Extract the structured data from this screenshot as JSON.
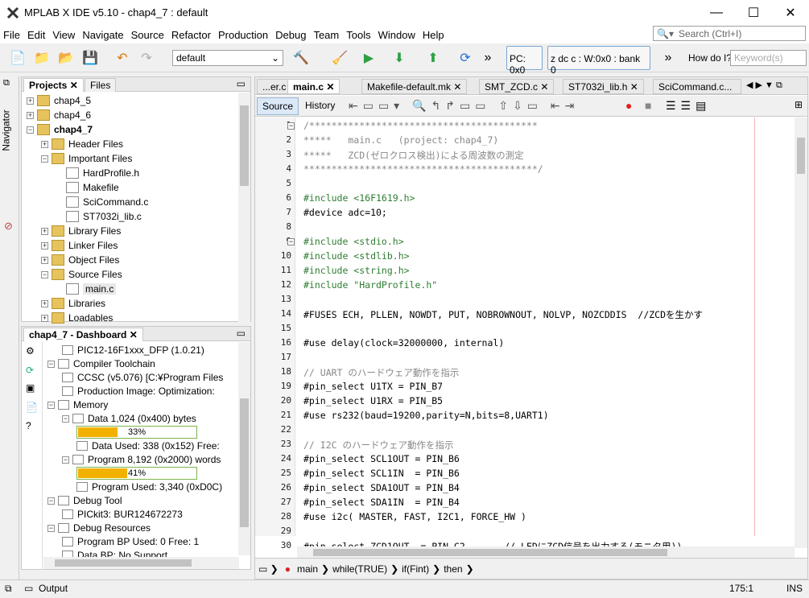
{
  "window": {
    "title": "MPLAB X IDE v5.10 - chap4_7 : default",
    "minimize": "—",
    "maximize": "☐",
    "close": "✕"
  },
  "menu": [
    "File",
    "Edit",
    "View",
    "Navigate",
    "Source",
    "Refactor",
    "Production",
    "Debug",
    "Team",
    "Tools",
    "Window",
    "Help"
  ],
  "search": {
    "placeholder": "Search (Ctrl+I)"
  },
  "toolbar": {
    "config": "default",
    "pc": "PC: 0x0",
    "status": "z dc c  : W:0x0 : bank 0",
    "howdoi_label": "How do I?",
    "howdoi_placeholder": "Keyword(s)"
  },
  "navigator": {
    "label": "Navigator"
  },
  "projects": {
    "tabs": [
      "Projects",
      "Files"
    ],
    "tree": [
      {
        "label": "chap4_5",
        "level": 0,
        "exp": "+",
        "icon": "project"
      },
      {
        "label": "chap4_6",
        "level": 0,
        "exp": "+",
        "icon": "project"
      },
      {
        "label": "chap4_7",
        "level": 0,
        "exp": "-",
        "icon": "project",
        "bold": true
      },
      {
        "label": "Header Files",
        "level": 1,
        "exp": "+",
        "icon": "folder"
      },
      {
        "label": "Important Files",
        "level": 1,
        "exp": "-",
        "icon": "folder"
      },
      {
        "label": "HardProfile.h",
        "level": 2,
        "icon": "file"
      },
      {
        "label": "Makefile",
        "level": 2,
        "icon": "file"
      },
      {
        "label": "SciCommand.c",
        "level": 2,
        "icon": "file"
      },
      {
        "label": "ST7032i_lib.c",
        "level": 2,
        "icon": "file"
      },
      {
        "label": "Library Files",
        "level": 1,
        "exp": "+",
        "icon": "folder"
      },
      {
        "label": "Linker Files",
        "level": 1,
        "exp": "+",
        "icon": "folder"
      },
      {
        "label": "Object Files",
        "level": 1,
        "exp": "+",
        "icon": "folder"
      },
      {
        "label": "Source Files",
        "level": 1,
        "exp": "-",
        "icon": "folder"
      },
      {
        "label": "main.c",
        "level": 2,
        "icon": "file",
        "selected": true
      },
      {
        "label": "Libraries",
        "level": 1,
        "exp": "+",
        "icon": "folder"
      },
      {
        "label": "Loadables",
        "level": 1,
        "exp": "+",
        "icon": "folder"
      }
    ]
  },
  "dashboard": {
    "tab": "chap4_7 - Dashboard",
    "rows": [
      {
        "label": "PIC12-16F1xxx_DFP (1.0.21)",
        "level": 1
      },
      {
        "label": "Compiler Toolchain",
        "level": 0,
        "exp": "-"
      },
      {
        "label": "CCSC (v5.076) [C:¥Program Files",
        "level": 1
      },
      {
        "label": "Production Image: Optimization:",
        "level": 1
      },
      {
        "label": "Memory",
        "level": 0,
        "exp": "-"
      },
      {
        "label": "Data 1,024 (0x400) bytes",
        "level": 1,
        "exp": "-"
      },
      {
        "label": "",
        "level": 2,
        "bar": true
      },
      {
        "label": "Data Used: 338 (0x152) Free:",
        "level": 2
      },
      {
        "label": "Program 8,192 (0x2000) words",
        "level": 1,
        "exp": "-"
      },
      {
        "label": "",
        "level": 2,
        "bar": true
      },
      {
        "label": "Program Used: 3,340 (0xD0C)",
        "level": 2
      },
      {
        "label": "Debug Tool",
        "level": 0,
        "exp": "-"
      },
      {
        "label": "PICkit3: BUR124672273",
        "level": 1
      },
      {
        "label": "Debug Resources",
        "level": 0,
        "exp": "-"
      },
      {
        "label": "Program BP Used: 0  Free: 1",
        "level": 1
      },
      {
        "label": "Data BP: No Support",
        "level": 1
      }
    ],
    "data_pct": "33%",
    "data_fraction": 0.33,
    "prog_pct": "41%",
    "prog_fraction": 0.41
  },
  "editor": {
    "tabs": [
      "...er.c",
      "main.c",
      "Makefile-default.mk",
      "SMT_ZCD.c",
      "ST7032i_lib.h",
      "SciCommand.c..."
    ],
    "subtabs": [
      "Source",
      "History"
    ],
    "lines": [
      {
        "n": "1",
        "t": "/*****************************************",
        "k": "comment"
      },
      {
        "n": "2",
        "t": "*****   main.c   (project: chap4_7)",
        "k": "comment"
      },
      {
        "n": "3",
        "t": "*****   ZCD(ゼロクロス検出)による周波数の測定",
        "k": "comment"
      },
      {
        "n": "4",
        "t": "******************************************/",
        "k": "comment"
      },
      {
        "n": "5",
        "t": "",
        "k": ""
      },
      {
        "n": "6",
        "t": "#include <16F1619.h>",
        "k": "inc"
      },
      {
        "n": "7",
        "t": "#device adc=10;",
        "k": ""
      },
      {
        "n": "8",
        "t": "",
        "k": ""
      },
      {
        "n": "9",
        "t": "#include <stdio.h>",
        "k": "inc"
      },
      {
        "n": "10",
        "t": "#include <stdlib.h>",
        "k": "inc"
      },
      {
        "n": "11",
        "t": "#include <string.h>",
        "k": "inc"
      },
      {
        "n": "12",
        "t": "#include \"HardProfile.h\"",
        "k": "inc"
      },
      {
        "n": "13",
        "t": "",
        "k": ""
      },
      {
        "n": "14",
        "t": "#FUSES ECH, PLLEN, NOWDT, PUT, NOBROWNOUT, NOLVP, NOZCDDIS  //ZCDを生かす",
        "k": ""
      },
      {
        "n": "15",
        "t": "",
        "k": ""
      },
      {
        "n": "16",
        "t": "#use delay(clock=32000000, internal)",
        "k": ""
      },
      {
        "n": "17",
        "t": "",
        "k": ""
      },
      {
        "n": "18",
        "t": "// UART のハードウェア動作を指示",
        "k": "comment"
      },
      {
        "n": "19",
        "t": "#pin_select U1TX = PIN_B7",
        "k": ""
      },
      {
        "n": "20",
        "t": "#pin_select U1RX = PIN_B5",
        "k": ""
      },
      {
        "n": "21",
        "t": "#use rs232(baud=19200,parity=N,bits=8,UART1)",
        "k": ""
      },
      {
        "n": "22",
        "t": "",
        "k": ""
      },
      {
        "n": "23",
        "t": "// I2C のハードウェア動作を指示",
        "k": "comment"
      },
      {
        "n": "24",
        "t": "#pin_select SCL1OUT = PIN_B6",
        "k": ""
      },
      {
        "n": "25",
        "t": "#pin_select SCL1IN  = PIN_B6",
        "k": ""
      },
      {
        "n": "26",
        "t": "#pin_select SDA1OUT = PIN_B4",
        "k": ""
      },
      {
        "n": "27",
        "t": "#pin_select SDA1IN  = PIN_B4",
        "k": ""
      },
      {
        "n": "28",
        "t": "#use i2c( MASTER, FAST, I2C1, FORCE_HW )",
        "k": ""
      },
      {
        "n": "29",
        "t": "",
        "k": ""
      },
      {
        "n": "30",
        "t": "#pin_select ZCD1OUT  = PIN_C2       // LEDにZCD信号を出力する(モニタ用))",
        "k": ""
      }
    ],
    "breadcrumb": [
      "main",
      "while(TRUE)",
      "if(Fint)",
      "then"
    ]
  },
  "status": {
    "output": "Output",
    "position": "175:1",
    "mode": "INS"
  }
}
